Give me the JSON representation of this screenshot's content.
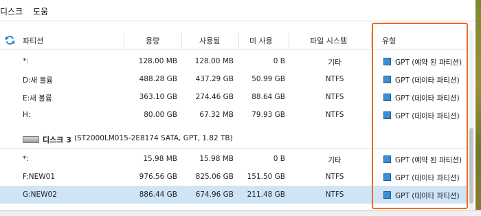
{
  "menu": {
    "disk": "디스크",
    "help": "도움"
  },
  "table": {
    "columns": {
      "partition": "파티션",
      "capacity": "용량",
      "used": "사용됨",
      "unused": "미 사용",
      "filesystem": "파일 시스템",
      "type": "유형"
    },
    "rows": [
      {
        "partition": "*:",
        "capacity": "128.00 MB",
        "used": "128.00 MB",
        "unused": "0 B",
        "filesystem": "기타",
        "type": "GPT (예약 된 파티션)"
      },
      {
        "partition": "D:새 볼륨",
        "capacity": "488.28 GB",
        "used": "437.29 GB",
        "unused": "50.99 GB",
        "filesystem": "NTFS",
        "type": "GPT (데이타 파티션)"
      },
      {
        "partition": "E:새 볼륨",
        "capacity": "363.10 GB",
        "used": "274.46 GB",
        "unused": "88.64 GB",
        "filesystem": "NTFS",
        "type": "GPT (데이타 파티션)"
      },
      {
        "partition": "H:",
        "capacity": "80.00 GB",
        "used": "67.32 MB",
        "unused": "79.93 GB",
        "filesystem": "NTFS",
        "type": "GPT (데이타 파티션)"
      }
    ],
    "disk3": {
      "name": "디스크 3",
      "info": "(ST2000LM015-2E8174 SATA, GPT, 1.82 TB)"
    },
    "rows2": [
      {
        "partition": "*:",
        "capacity": "15.98 MB",
        "used": "15.98 MB",
        "unused": "0 B",
        "filesystem": "기타",
        "type": "GPT (예약 된 파티션)"
      },
      {
        "partition": "F:NEW01",
        "capacity": "976.56 GB",
        "used": "825.06 GB",
        "unused": "151.50 GB",
        "filesystem": "NTFS",
        "type": "GPT (데이타 파티션)"
      },
      {
        "partition": "G:NEW02",
        "capacity": "886.44 GB",
        "used": "674.96 GB",
        "unused": "211.48 GB",
        "filesystem": "NTFS",
        "type": "GPT (데이타 파티션)"
      }
    ]
  },
  "colors": {
    "highlight": "#f26a21",
    "selected_row": "#cfe5f7",
    "type_icon": "#3a8fd6"
  },
  "icons": {
    "refresh": "refresh-icon",
    "disk": "hard-disk-icon",
    "partition_type": "partition-square-icon"
  }
}
